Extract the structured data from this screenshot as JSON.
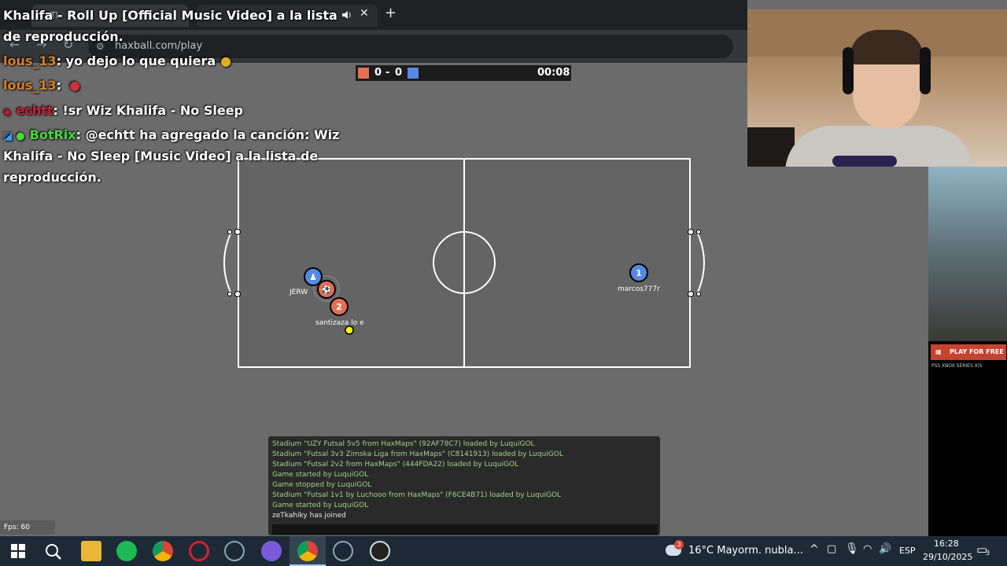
{
  "browser": {
    "tab_hidden_text": "Tl",
    "new_tab_glyph": "+",
    "url": "haxball.com/play",
    "nav": {
      "back": "←",
      "forward": "→",
      "reload": "↻",
      "site": "⚙"
    }
  },
  "stream_overlay": {
    "messages": [
      {
        "user": "",
        "text": "Khalifa - Roll Up [Official Music Video] a la lista",
        "user_color": "#ffffff"
      },
      {
        "user": "",
        "text": "de reproducción.",
        "user_color": "#ffffff"
      },
      {
        "user": "lous_13",
        "text": ": yo dejo lo que quiera",
        "user_color": "#d4822a"
      },
      {
        "user": "lous_13",
        "text": ":",
        "user_color": "#d4822a"
      },
      {
        "user": "echtt",
        "text": ": !sr Wiz Khalifa - No Sleep",
        "user_color": "#cc1f3a"
      },
      {
        "user": "BotRix",
        "text": ": @echtt ha agregado la canción: Wiz",
        "user_color": "#48d93c"
      },
      {
        "user": "",
        "text": "Khalifa - No Sleep [Music Video] a la lista de",
        "user_color": "#ffffff"
      },
      {
        "user": "",
        "text": "reproducción.",
        "user_color": "#ffffff"
      }
    ]
  },
  "game": {
    "score_red": "0",
    "score_sep": "-",
    "score_blue": "0",
    "timer": "00:08",
    "red_color": "#e56e56",
    "blue_color": "#5689e5",
    "players": [
      {
        "name": "JERW",
        "team": "blue",
        "number": "",
        "avatar": "pawn-icon"
      },
      {
        "name": "",
        "team": "red",
        "number": "",
        "avatar": "soccer-ball-icon"
      },
      {
        "name": "santizaza lo e",
        "team": "red",
        "number": "2"
      },
      {
        "name": "marcos777r",
        "team": "blue",
        "number": "1"
      }
    ],
    "ball_color": "#ffff00"
  },
  "game_log": [
    "Stadium \"UZY Futsal 5v5 from HaxMaps\" (92AF78C7) loaded by LuquiGOL",
    "Stadium \"Futsal 3v3 Zimska Liga from HaxMaps\" (C8141913) loaded by LuquiGOL",
    "Stadium \"Futsal 2v2 from HaxMaps\" (444FDA22) loaded by LuquiGOL",
    "Game started by LuquiGOL",
    "Game stopped by LuquiGOL",
    "Stadium \"Futsal 1v1 by Luchooo from HaxMaps\" (F6CE4B71) loaded by LuquiGOL",
    "Game started by LuquiGOL",
    "zeTkahiky has joined"
  ],
  "fps_label": "Fps: 60",
  "ad": {
    "cta": "PLAY FOR FREE",
    "platforms": "PS5  XBOX SERIES X|S"
  },
  "taskbar": {
    "weather": "16°C  Mayorm. nubla...",
    "notification_badge": "3",
    "language": "ESP",
    "time": "16:28",
    "date": "29/10/2025",
    "notif_count": "3"
  }
}
